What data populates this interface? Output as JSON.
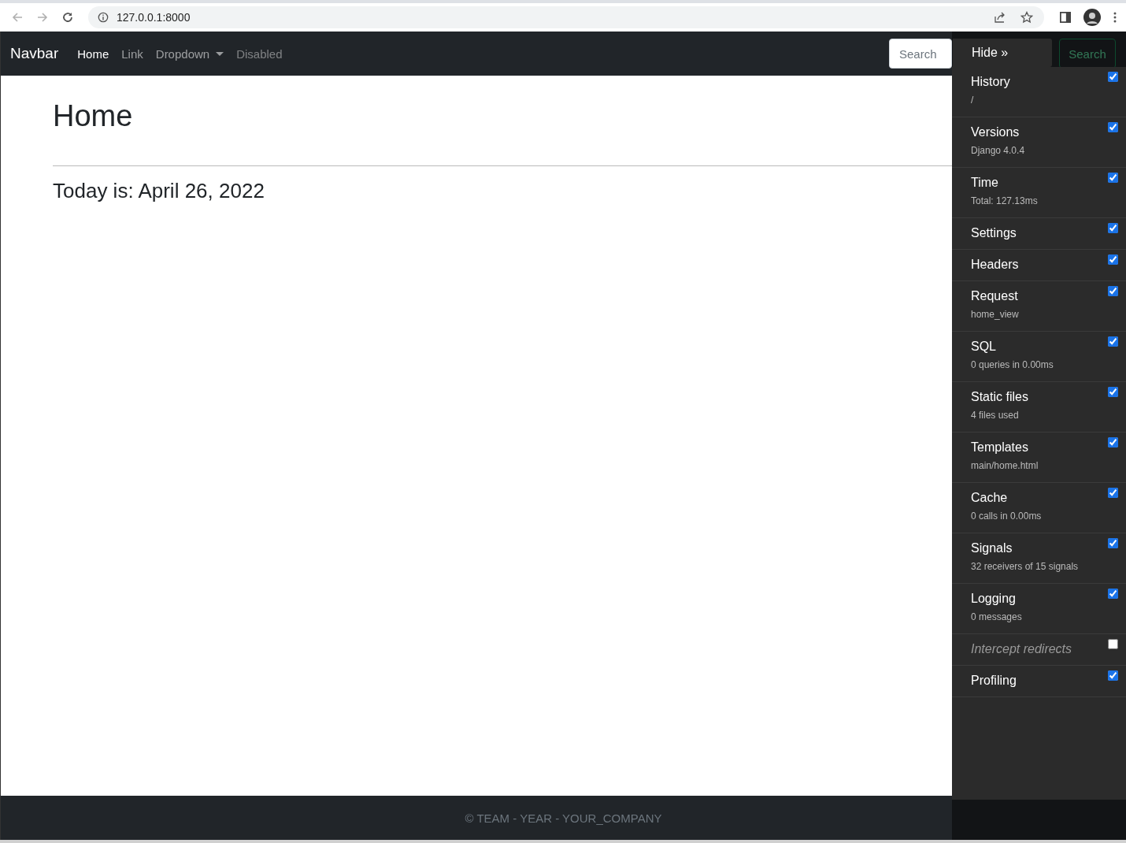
{
  "browser": {
    "url": "127.0.0.1:8000"
  },
  "navbar": {
    "brand": "Navbar",
    "links": [
      {
        "label": "Home",
        "kind": "active"
      },
      {
        "label": "Link",
        "kind": "link"
      },
      {
        "label": "Dropdown",
        "kind": "dropdown"
      },
      {
        "label": "Disabled",
        "kind": "disabled"
      }
    ],
    "search": {
      "placeholder": "Search"
    },
    "search_button": "Search"
  },
  "page": {
    "title": "Home",
    "date_line": "Today is: April 26, 2022"
  },
  "footer": "© TEAM - YEAR - YOUR_COMPANY",
  "debug_toolbar": {
    "hide_button": "Hide »",
    "panels": [
      {
        "title": "History",
        "subtitle": "/",
        "checked": true
      },
      {
        "title": "Versions",
        "subtitle": "Django 4.0.4",
        "checked": true
      },
      {
        "title": "Time",
        "subtitle": "Total: 127.13ms",
        "checked": true
      },
      {
        "title": "Settings",
        "checked": true
      },
      {
        "title": "Headers",
        "checked": true
      },
      {
        "title": "Request",
        "subtitle": "home_view",
        "checked": true
      },
      {
        "title": "SQL",
        "subtitle": "0 queries in 0.00ms",
        "checked": true
      },
      {
        "title": "Static files",
        "subtitle": "4 files used",
        "checked": true
      },
      {
        "title": "Templates",
        "subtitle": "main/home.html",
        "checked": true
      },
      {
        "title": "Cache",
        "subtitle": "0 calls in 0.00ms",
        "checked": true
      },
      {
        "title": "Signals",
        "subtitle": "32 receivers of 15 signals",
        "checked": true
      },
      {
        "title": "Logging",
        "subtitle": "0 messages",
        "checked": true
      },
      {
        "title": "Intercept redirects",
        "checked": false
      },
      {
        "title": "Profiling",
        "checked": true
      }
    ]
  }
}
